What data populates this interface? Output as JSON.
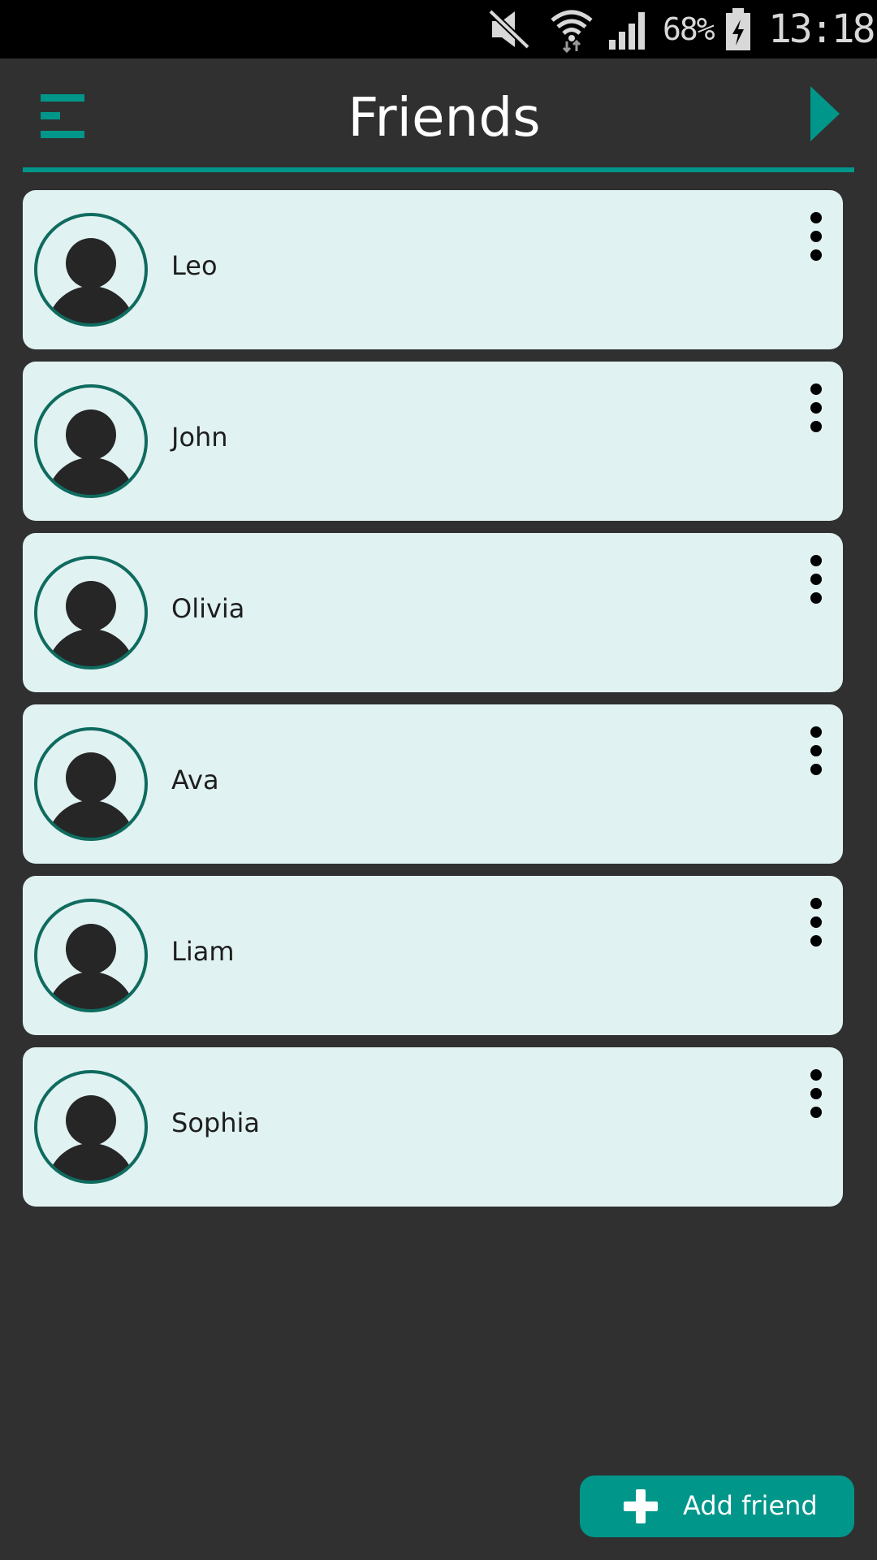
{
  "status_bar": {
    "battery_percent": "68%",
    "time": "13:18",
    "icons": [
      "mute-icon",
      "wifi-icon",
      "signal-icon",
      "battery-charging-icon"
    ]
  },
  "header": {
    "title": "Friends",
    "menu_icon": "hamburger-menu-icon",
    "next_icon": "play-arrow-icon"
  },
  "friends": [
    {
      "name": "Leo"
    },
    {
      "name": "John"
    },
    {
      "name": "Olivia"
    },
    {
      "name": "Ava"
    },
    {
      "name": "Liam"
    },
    {
      "name": "Sophia"
    }
  ],
  "add_button": {
    "label": "Add friend",
    "icon": "plus-icon"
  },
  "colors": {
    "background": "#303030",
    "accent": "#00968a",
    "card": "#e0f2f1",
    "avatar_ring": "#0f6b5f"
  }
}
